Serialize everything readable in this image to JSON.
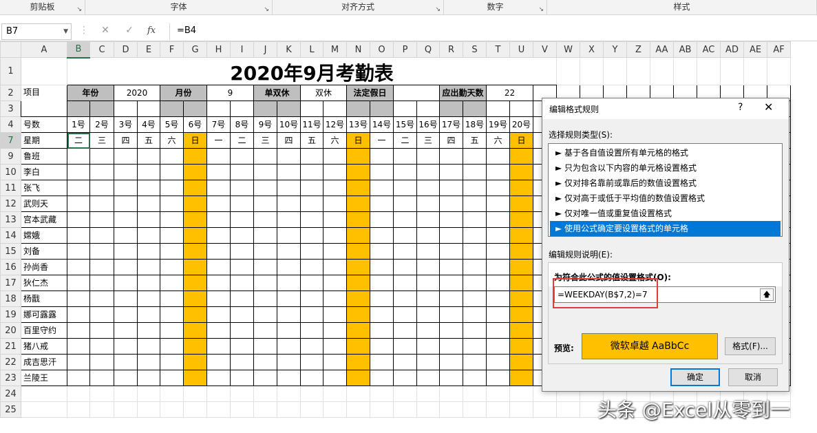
{
  "ribbon": {
    "groups": [
      "剪贴板",
      "字体",
      "对齐方式",
      "数字",
      "样式"
    ]
  },
  "formula_bar": {
    "name_box": "B7",
    "fx": "fx",
    "cancel": "✕",
    "enter": "✓",
    "formula": "=B4"
  },
  "columns": [
    "A",
    "B",
    "C",
    "D",
    "E",
    "F",
    "G",
    "H",
    "I",
    "J",
    "K",
    "L",
    "M",
    "N",
    "O",
    "P",
    "Q",
    "R",
    "S",
    "T",
    "U",
    "V",
    "W",
    "X",
    "Y",
    "Z",
    "AA",
    "AB",
    "AC",
    "AD",
    "AE",
    "AF"
  ],
  "sheet": {
    "title": "2020年9月考勤表",
    "row2": {
      "item_label": "项目",
      "year_label": "年份",
      "year_value": "2020",
      "month_label": "月份",
      "month_value": "9",
      "rest_label": "单双休",
      "rest_value": "双休",
      "holiday_label": "法定假日",
      "days_label": "应出勤天数",
      "days_value": "22"
    },
    "row4_label": "号数",
    "row7_label": "星期",
    "days": [
      "1号",
      "2号",
      "3号",
      "4号",
      "5号",
      "6号",
      "7号",
      "8号",
      "9号",
      "10号",
      "11号",
      "12号",
      "13号",
      "14号",
      "15号",
      "16号",
      "17号",
      "18号",
      "19号",
      "20号"
    ],
    "weekdays": [
      "二",
      "三",
      "四",
      "五",
      "六",
      "日",
      "一",
      "二",
      "三",
      "四",
      "五",
      "六",
      "日",
      "一",
      "二",
      "三",
      "四",
      "五",
      "六",
      "日"
    ],
    "names": [
      "鲁班",
      "李白",
      "张飞",
      "武则天",
      "宫本武藏",
      "嫦娥",
      "刘备",
      "孙尚香",
      "狄仁杰",
      "杨戬",
      "娜可露露",
      "百里守约",
      "猪八戒",
      "成吉思汗",
      "兰陵王"
    ],
    "row_numbers": [
      "1",
      "2",
      "3",
      "4",
      "7",
      "9",
      "10",
      "11",
      "12",
      "13",
      "14",
      "15",
      "16",
      "17",
      "18",
      "19",
      "20",
      "21",
      "22",
      "23",
      "24",
      "25"
    ]
  },
  "dialog": {
    "title": "编辑格式规则",
    "help": "?",
    "close": "✕",
    "type_label": "选择规则类型(S):",
    "rule_types": [
      "► 基于各自值设置所有单元格的格式",
      "► 只为包含以下内容的单元格设置格式",
      "► 仅对排名靠前或靠后的数值设置格式",
      "► 仅对高于或低于平均值的数值设置格式",
      "► 仅对唯一值或重复值设置格式",
      "► 使用公式确定要设置格式的单元格"
    ],
    "desc_label": "编辑规则说明(E):",
    "formula_label": "为符合此公式的值设置格式(O):",
    "formula": "=WEEKDAY(B$7,2)=7",
    "preview_label": "预览:",
    "preview_text": "微软卓越  AaBbCc",
    "format_button": "格式(F)...",
    "ok": "确定",
    "cancel": "取消"
  },
  "watermark": "头条 @Excel从零到一",
  "colors": {
    "weekend": "#ffc000",
    "header_gray": "#bfbfbf",
    "selection": "#0078d7",
    "excel_green": "#217346"
  }
}
